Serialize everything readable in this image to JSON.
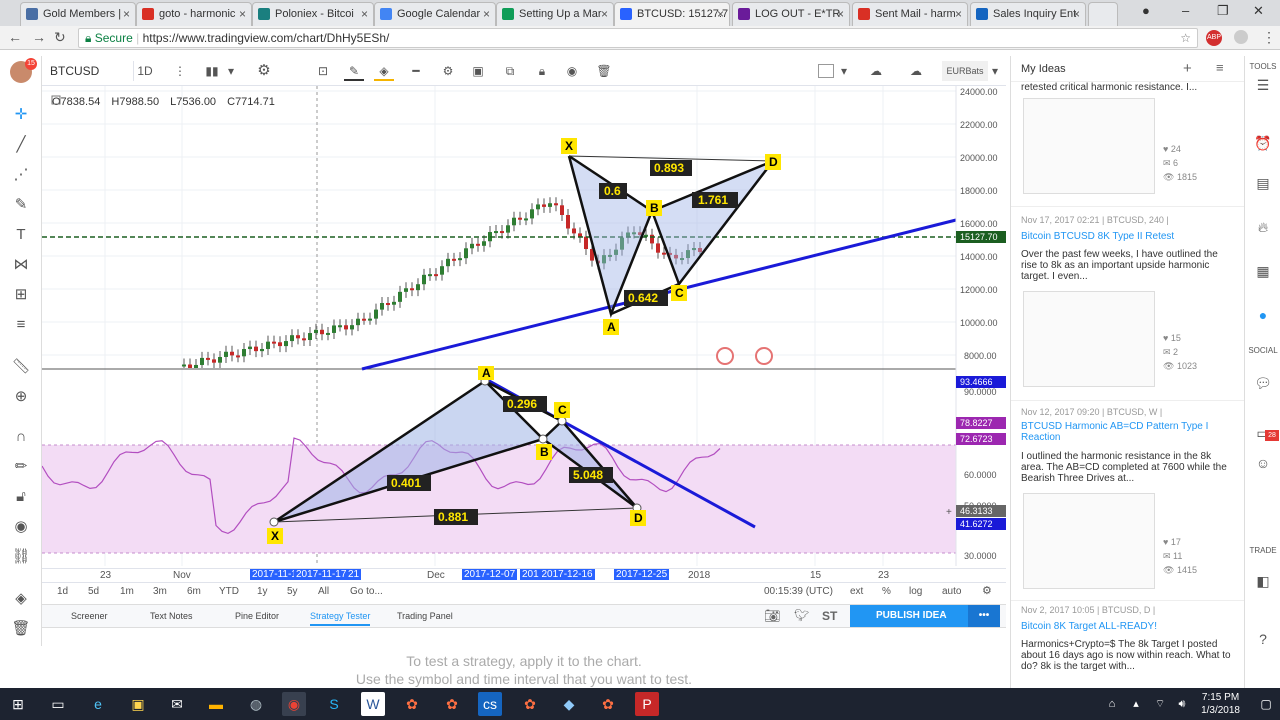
{
  "browser": {
    "tabs": [
      {
        "label": "Gold Members |",
        "color": "#4a6fa5"
      },
      {
        "label": "goto - harmonic",
        "color": "#d93025"
      },
      {
        "label": "Poloniex - Bitcoi",
        "color": "#1a7f7f"
      },
      {
        "label": "Google Calendar",
        "color": "#4285f4"
      },
      {
        "label": "Setting Up a Mar",
        "color": "#0f9d58"
      },
      {
        "label": "BTCUSD: 15127.7",
        "color": "#2962ff"
      },
      {
        "label": "LOG OUT - E*TR",
        "color": "#6a1b9a"
      },
      {
        "label": "Sent Mail - harm",
        "color": "#d93025"
      },
      {
        "label": "Sales Inquiry Ent",
        "color": "#1565c0"
      }
    ],
    "secure_label": "Secure",
    "url": "https://www.tradingview.com/chart/DhHy5ESh/"
  },
  "toolbar": {
    "symbol": "BTCUSD",
    "interval": "1D",
    "exchange": "EURBats",
    "ohlc": {
      "o": "O7838.54",
      "h": "H7988.50",
      "l": "L7536.00",
      "c": "C7714.71"
    }
  },
  "price_axis": {
    "labels": [
      "24000.00",
      "22000.00",
      "20000.00",
      "18000.00",
      "16000.00",
      "14000.00",
      "12000.00",
      "10000.00",
      "8000.00"
    ],
    "current_price": "15127.70"
  },
  "indicator_axis": {
    "labels": [
      "90.0000",
      "70.0000",
      "60.0000",
      "50.0000",
      "30.0000"
    ],
    "markers": [
      "93.4666",
      "78.8227",
      "72.6723",
      "46.3133",
      "41.6272"
    ]
  },
  "upper_pattern": {
    "points": [
      "X",
      "A",
      "B",
      "C",
      "D"
    ],
    "ratios": [
      "0.893",
      "0.6",
      "1.761",
      "0.642"
    ]
  },
  "lower_pattern": {
    "points": [
      "X",
      "A",
      "B",
      "C",
      "D"
    ],
    "ratios": [
      "0.296",
      "0.401",
      "5.048",
      "0.881"
    ]
  },
  "time_axis": {
    "labels": [
      "23",
      "Nov",
      "Dec",
      "2018",
      "15",
      "23"
    ],
    "highlights": [
      "2017-11-1",
      "2017-11-17",
      "21",
      "2017-12-07",
      "201 2017-12-16",
      "9",
      "2017-12-25"
    ]
  },
  "range_bar": {
    "ranges": [
      "1d",
      "5d",
      "1m",
      "3m",
      "6m",
      "YTD",
      "1y",
      "5y",
      "All"
    ],
    "goto": "Go to...",
    "time": "00:15:39 (UTC)",
    "options": [
      "ext",
      "%",
      "log",
      "auto"
    ]
  },
  "bottom_tabs": [
    "Screener",
    "Text Notes",
    "Pine Editor",
    "Strategy Tester",
    "Trading Panel"
  ],
  "publish_label": "PUBLISH IDEA",
  "strategy_message": [
    "To test a strategy, apply it to the chart.",
    "Use the symbol and time interval that you want to test."
  ],
  "right_panel": {
    "title": "My Ideas",
    "ideas": [
      {
        "meta": "",
        "title": "",
        "desc": "retested critical harmonic resistance. I...",
        "stats": [
          "24",
          "6",
          "1815"
        ]
      },
      {
        "meta": "Nov 17, 2017 02:21 | BTCUSD, 240 |",
        "title": "Bitcoin BTCUSD 8K Type II Retest",
        "desc": "Over the past few weeks, I have outlined the rise to 8k as an important upside harmonic target. I even...",
        "stats": [
          "15",
          "2",
          "1023"
        ]
      },
      {
        "meta": "Nov 12, 2017 09:20 | BTCUSD, W |",
        "title": "BTCUSD Harmonic AB=CD Pattern Type I Reaction",
        "desc": "I outlined the harmonic resistance in the 8k area. The AB=CD completed at 7600 while the Bearish Three Drives at...",
        "stats": [
          "17",
          "11",
          "1415"
        ]
      },
      {
        "meta": "Nov 2, 2017 10:05 | BTCUSD, D |",
        "title": "Bitcoin 8K Target ALL-READY!",
        "desc": "Harmonics+Crypto=$ The 8k Target I posted about 16 days ago is now within reach. What to do? 8k is the target with...",
        "stats": []
      }
    ]
  },
  "widgetbar": {
    "labels": [
      "TOOLS",
      "SOCIAL",
      "TRADE"
    ],
    "badges": [
      "28"
    ]
  },
  "taskbar": {
    "time": "7:15 PM",
    "date": "1/3/2018"
  }
}
